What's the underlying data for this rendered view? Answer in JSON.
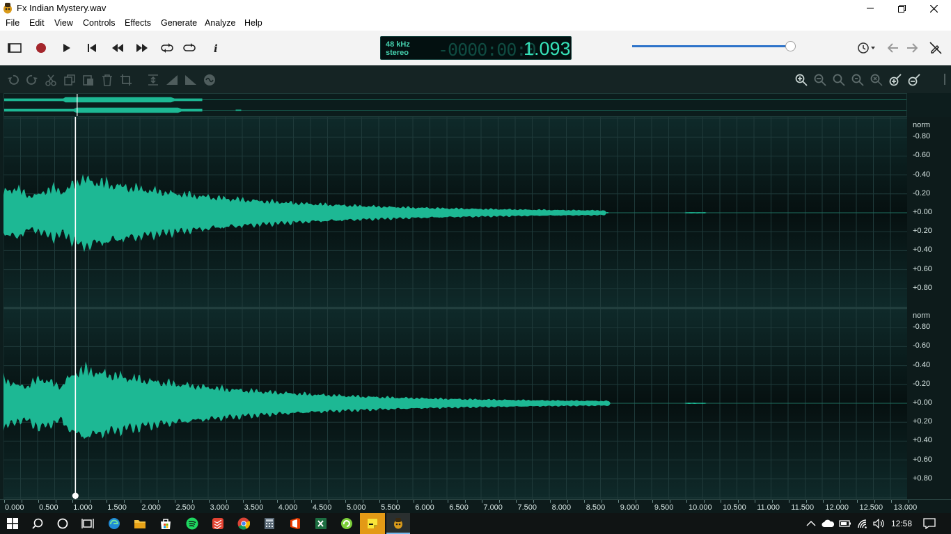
{
  "window": {
    "title": "Fx Indian Mystery.wav"
  },
  "menu": [
    "File",
    "Edit",
    "View",
    "Controls",
    "Effects",
    "Generate",
    "Analyze",
    "Help"
  ],
  "lcd": {
    "sample_rate": "48 kHz",
    "channels": "stereo",
    "time_dim": "-0000:00:0",
    "time_bright": "1.093"
  },
  "volume_level": 0.98,
  "waveform": {
    "color": "#1db894",
    "playhead_seconds": 0.93
  },
  "vertical_scale": {
    "channel1": [
      "norm",
      "+0.80",
      "+0.60",
      "+0.40",
      "+0.20",
      "+0.00",
      "-0.20",
      "-0.40",
      "-0.60",
      "-0.80"
    ],
    "channel2": [
      "norm",
      "+0.80",
      "+0.60",
      "+0.40",
      "+0.20",
      "+0.00",
      "-0.20",
      "-0.40",
      "-0.60",
      "-0.80"
    ]
  },
  "time_axis": [
    "0.000",
    "0.500",
    "1.000",
    "1.500",
    "2.000",
    "2.500",
    "3.000",
    "3.500",
    "4.000",
    "4.500",
    "5.000",
    "5.500",
    "6.000",
    "6.500",
    "7.000",
    "7.500",
    "8.000",
    "8.500",
    "9.000",
    "9.500",
    "10.000",
    "10.500",
    "11.000",
    "11.500",
    "12.000",
    "12.500",
    "13.000"
  ],
  "taskbar": {
    "clock": "12:58"
  },
  "colors": {
    "accent": "#1db894",
    "background": "#0d1d1d",
    "slider": "#2d73c9"
  }
}
